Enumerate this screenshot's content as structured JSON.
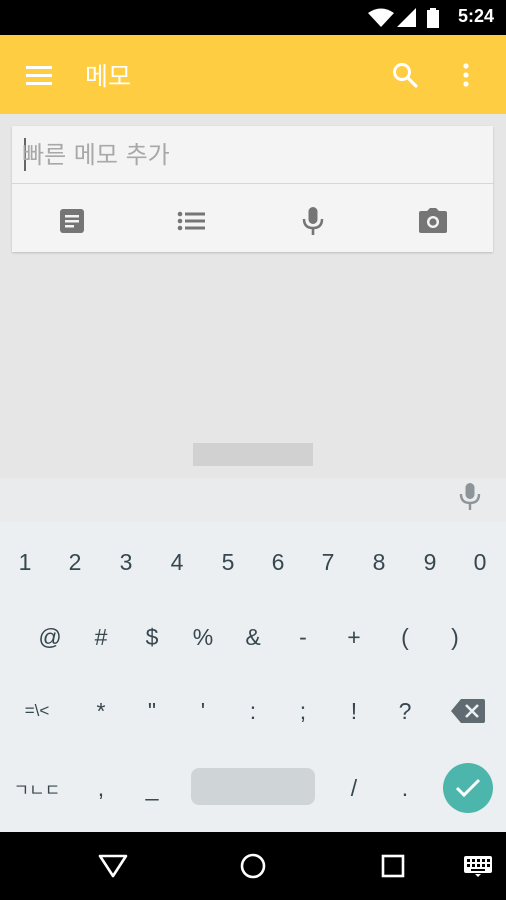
{
  "status_bar": {
    "time": "5:24",
    "icons": [
      "wifi-icon",
      "signal-icon",
      "battery-icon"
    ]
  },
  "app_bar": {
    "title": "메모",
    "color": "#ffcd41",
    "icons": [
      "menu-icon",
      "search-icon",
      "more-vert-icon"
    ]
  },
  "quick_note": {
    "placeholder": "빠른 메모 추가",
    "tools": [
      "note-icon",
      "list-icon",
      "mic-icon",
      "camera-icon"
    ]
  },
  "keyboard": {
    "row1": [
      "1",
      "2",
      "3",
      "4",
      "5",
      "6",
      "7",
      "8",
      "9",
      "0"
    ],
    "row2": [
      "@",
      "#",
      "$",
      "%",
      "&",
      "-",
      "+",
      "(",
      ")"
    ],
    "row3": [
      "=\\<",
      "*",
      "\"",
      "'",
      ":",
      ";",
      "!",
      "?"
    ],
    "row4": [
      "ㄱㄴㄷ",
      ",",
      "_",
      "/",
      "."
    ],
    "accent_color": "#4db6ac"
  },
  "nav_bar": {
    "icons": [
      "back-icon",
      "home-icon",
      "recents-icon",
      "keyboard-icon"
    ]
  }
}
